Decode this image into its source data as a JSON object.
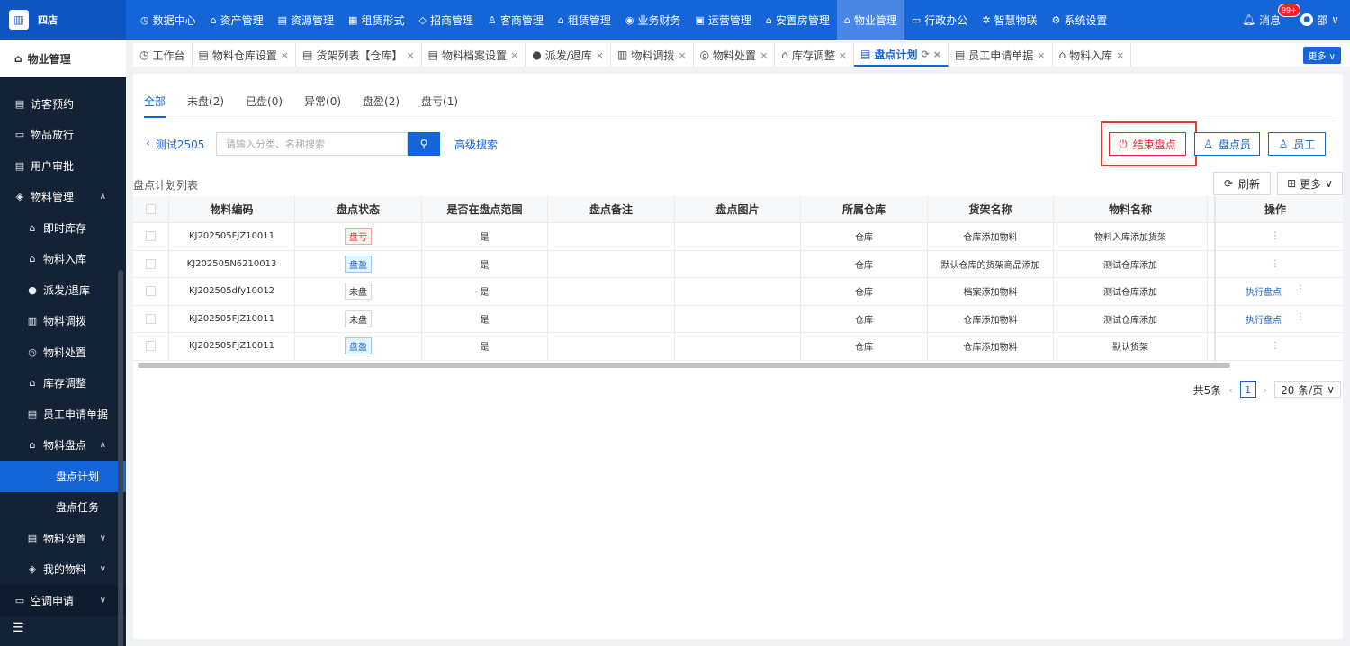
{
  "brand": {
    "name": "四店"
  },
  "topnav": [
    {
      "label": "数据中心",
      "icon": "◷"
    },
    {
      "label": "资产管理",
      "icon": "⌂"
    },
    {
      "label": "资源管理",
      "icon": "▤"
    },
    {
      "label": "租赁形式",
      "icon": "▦"
    },
    {
      "label": "招商管理",
      "icon": "◇"
    },
    {
      "label": "客商管理",
      "icon": "♙"
    },
    {
      "label": "租赁管理",
      "icon": "⌂"
    },
    {
      "label": "业务财务",
      "icon": "◉"
    },
    {
      "label": "运营管理",
      "icon": "▣"
    },
    {
      "label": "安置房管理",
      "icon": "⌂"
    },
    {
      "label": "物业管理",
      "icon": "⌂"
    },
    {
      "label": "行政办公",
      "icon": "▭"
    },
    {
      "label": "智慧物联",
      "icon": "✲"
    },
    {
      "label": "系统设置",
      "icon": "⚙"
    }
  ],
  "top_right": {
    "message_label": "消息",
    "message_badge": "99+",
    "user_name": "邵"
  },
  "sidebar": {
    "header": "物业管理",
    "items": [
      {
        "label": "访客预约",
        "icon": "▤"
      },
      {
        "label": "物品放行",
        "icon": "▭"
      },
      {
        "label": "用户审批",
        "icon": "▤"
      },
      {
        "label": "物料管理",
        "icon": "◈"
      },
      {
        "label": "即时库存",
        "icon": "⌂"
      },
      {
        "label": "物料入库",
        "icon": "⌂"
      },
      {
        "label": "派发/退库",
        "icon": "●"
      },
      {
        "label": "物料调拨",
        "icon": "▥"
      },
      {
        "label": "物料处置",
        "icon": "◎"
      },
      {
        "label": "库存调整",
        "icon": "⌂"
      },
      {
        "label": "员工申请单据",
        "icon": "▤"
      },
      {
        "label": "物料盘点",
        "icon": "⌂"
      },
      {
        "label": "盘点计划",
        "icon": ""
      },
      {
        "label": "盘点任务",
        "icon": ""
      },
      {
        "label": "物料设置",
        "icon": "▤"
      },
      {
        "label": "我的物料",
        "icon": "◈"
      },
      {
        "label": "空调申请",
        "icon": "▭"
      }
    ]
  },
  "tabs": [
    {
      "label": "工作台",
      "icon": "◷"
    },
    {
      "label": "物料仓库设置",
      "icon": "▤"
    },
    {
      "label": "货架列表【仓库】",
      "icon": "▤"
    },
    {
      "label": "物料档案设置",
      "icon": "▤"
    },
    {
      "label": "派发/退库",
      "icon": "●"
    },
    {
      "label": "物料调拨",
      "icon": "▥"
    },
    {
      "label": "物料处置",
      "icon": "◎"
    },
    {
      "label": "库存调整",
      "icon": "⌂"
    },
    {
      "label": "盘点计划",
      "icon": "▤"
    },
    {
      "label": "员工申请单据",
      "icon": "▤"
    },
    {
      "label": "物料入库",
      "icon": "⌂"
    }
  ],
  "tab_more_label": "更多 ∨",
  "subtabs": [
    "全部",
    "未盘(2)",
    "已盘(0)",
    "异常(0)",
    "盘盈(2)",
    "盘亏(1)"
  ],
  "plan_name": "测试2505",
  "search": {
    "placeholder": "请输入分类、名称搜索"
  },
  "advanced_search_label": "高级搜索",
  "actions": {
    "end_label": "结束盘点",
    "checker_label": "盘点员",
    "employee_label": "员工"
  },
  "list_title": "盘点计划列表",
  "refresh_label": "刷新",
  "more_label": "更多",
  "columns": [
    "物料编码",
    "盘点状态",
    "是否在盘点范围",
    "盘点备注",
    "盘点图片",
    "所属仓库",
    "货架名称",
    "物料名称",
    "操作"
  ],
  "rows": [
    {
      "code": "KJ202505FJZ10011",
      "status": "盘亏",
      "status_type": "red",
      "in_range": "是",
      "remark": "",
      "image": "",
      "warehouse": "仓库",
      "shelf": "仓库添加物料",
      "material": "物料入库添加货架",
      "op": ""
    },
    {
      "code": "KJ202505N6210013",
      "status": "盘盈",
      "status_type": "blue",
      "in_range": "是",
      "remark": "",
      "image": "",
      "warehouse": "仓库",
      "shelf": "默认仓库的货架商品添加",
      "material": "测试仓库添加",
      "op": ""
    },
    {
      "code": "KJ202505dfy10012",
      "status": "未盘",
      "status_type": "gray",
      "in_range": "是",
      "remark": "",
      "image": "",
      "warehouse": "仓库",
      "shelf": "档案添加物料",
      "material": "测试仓库添加",
      "op": "执行盘点"
    },
    {
      "code": "KJ202505FJZ10011",
      "status": "未盘",
      "status_type": "gray",
      "in_range": "是",
      "remark": "",
      "image": "",
      "warehouse": "仓库",
      "shelf": "仓库添加物料",
      "material": "测试仓库添加",
      "op": "执行盘点"
    },
    {
      "code": "KJ202505FJZ10011",
      "status": "盘盈",
      "status_type": "blue",
      "in_range": "是",
      "remark": "",
      "image": "",
      "warehouse": "仓库",
      "shelf": "仓库添加物料",
      "material": "默认货架",
      "op": ""
    }
  ],
  "pager": {
    "total": "共5条",
    "current": "1",
    "page_size": "20 条/页"
  },
  "colors": {
    "primary": "#1565d8",
    "danger": "#f5222d",
    "sidebar_bg": "#132235"
  }
}
